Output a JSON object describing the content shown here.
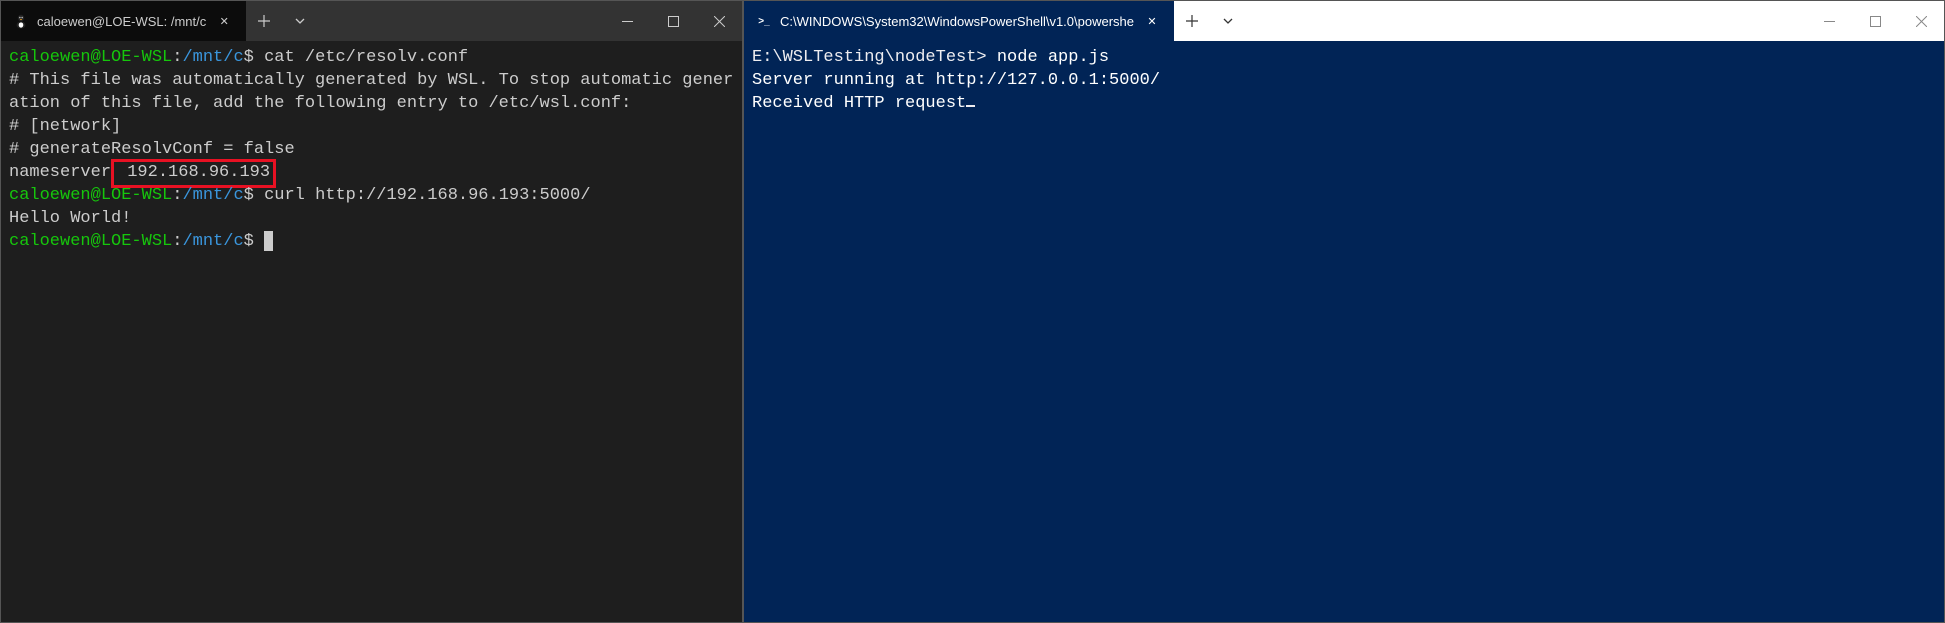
{
  "left_window": {
    "tab": {
      "title": "caloewen@LOE-WSL: /mnt/c",
      "close_glyph": "✕"
    },
    "terminal": {
      "line1": {
        "user": "caloewen@LOE-WSL",
        "colon": ":",
        "path": "/mnt/c",
        "dollar": "$ ",
        "cmd": "cat /etc/resolv.conf"
      },
      "comment_block": "# This file was automatically generated by WSL. To stop automatic generation of this file, add the following entry to /etc/wsl.conf:\n# [network]\n# generateResolvConf = false",
      "nameserver_label": "nameserver",
      "nameserver_ip": " 192.168.96.193",
      "line2": {
        "user": "caloewen@LOE-WSL",
        "colon": ":",
        "path": "/mnt/c",
        "dollar": "$ ",
        "cmd": "curl http://192.168.96.193:5000/"
      },
      "hello": "Hello World!",
      "line3": {
        "user": "caloewen@LOE-WSL",
        "colon": ":",
        "path": "/mnt/c",
        "dollar": "$ "
      }
    }
  },
  "right_window": {
    "tab": {
      "title": "C:\\WINDOWS\\System32\\WindowsPowerShell\\v1.0\\powershe",
      "close_glyph": "✕"
    },
    "terminal": {
      "prompt_path": "E:\\WSLTesting\\nodeTest> ",
      "cmd": "node app.js",
      "out1": "Server running at http://127.0.0.1:5000/",
      "out2": "Received HTTP request"
    }
  },
  "icons": {
    "ps_label": ">_"
  }
}
